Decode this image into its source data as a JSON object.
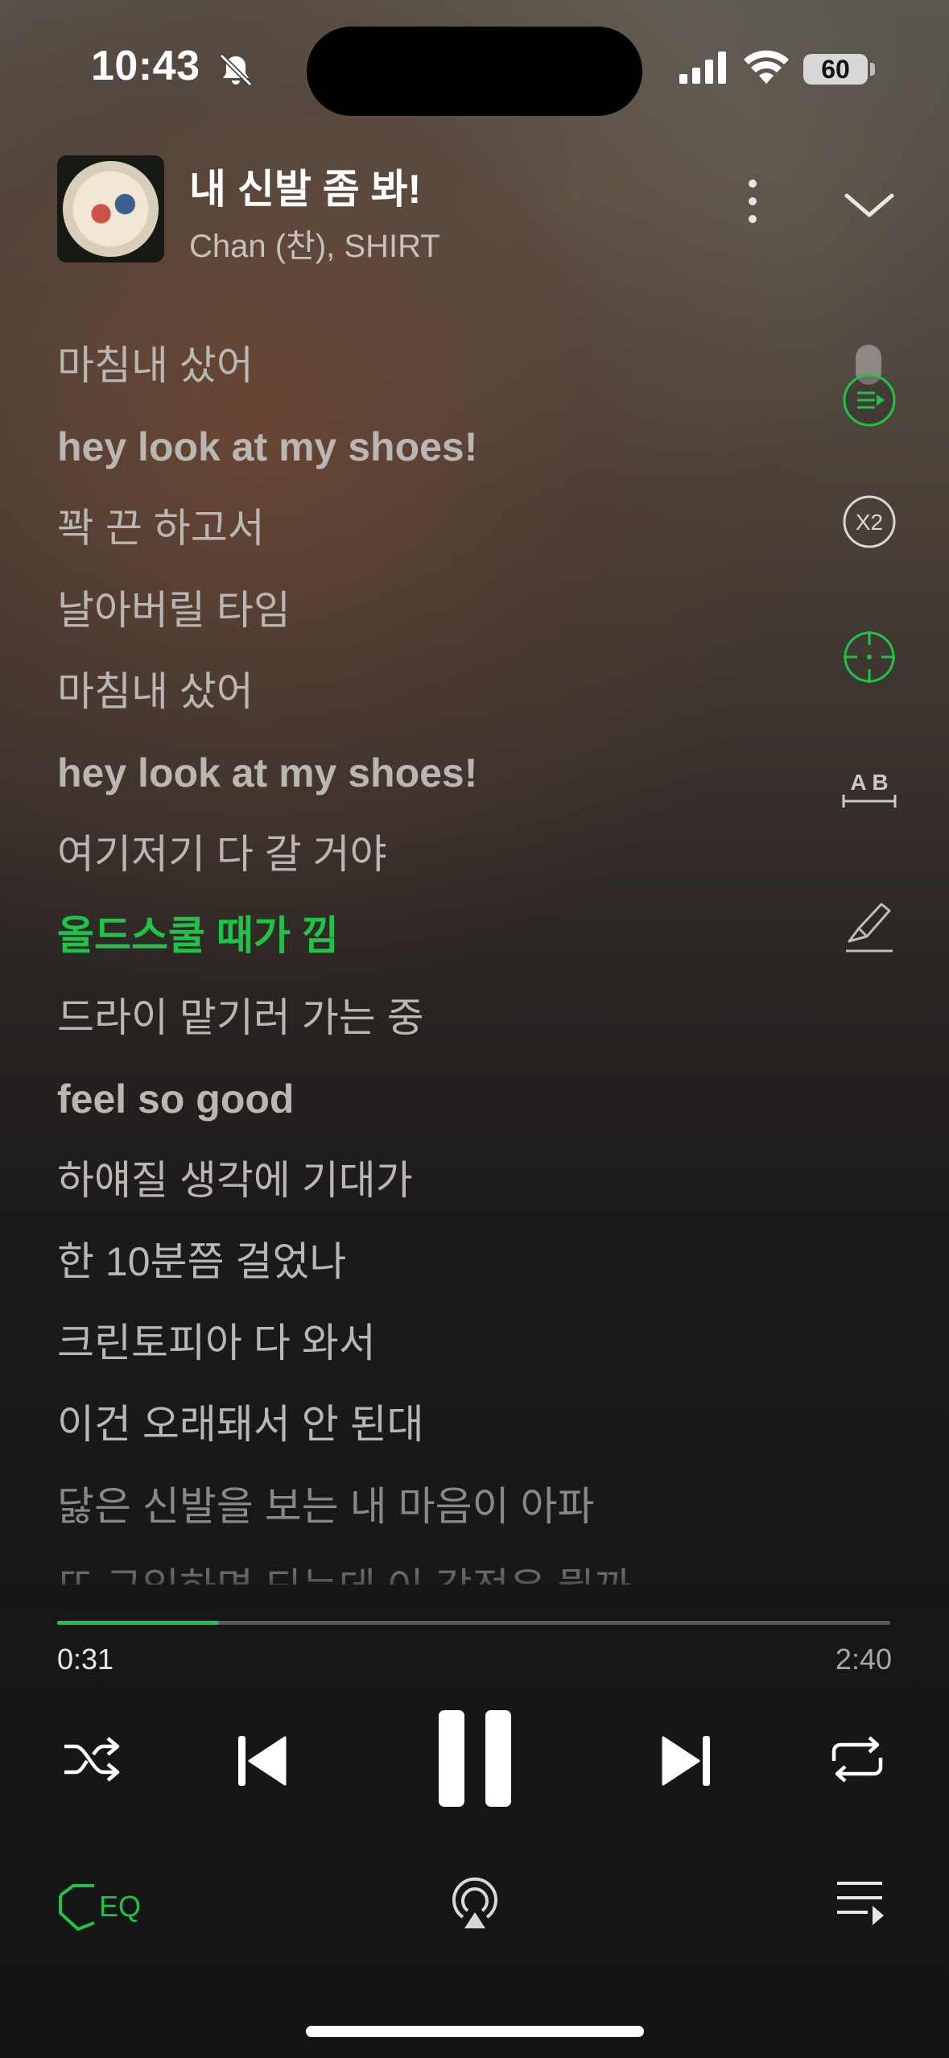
{
  "status_bar": {
    "time": "10:43",
    "battery": "60"
  },
  "now_playing": {
    "title": "내 신발 좀 봐!",
    "artist": "Chan (찬), SHIRT"
  },
  "lyrics": [
    {
      "text": "마침내 샀어",
      "style": "normal"
    },
    {
      "text": "hey look at my shoes!",
      "style": "bold"
    },
    {
      "text": "꽉 끈 하고서",
      "style": "normal"
    },
    {
      "text": "날아버릴 타임",
      "style": "normal"
    },
    {
      "text": "마침내 샀어",
      "style": "normal"
    },
    {
      "text": "hey look at my shoes!",
      "style": "bold"
    },
    {
      "text": "여기저기 다 갈 거야",
      "style": "normal"
    },
    {
      "text": "올드스쿨 때가 낌",
      "style": "active"
    },
    {
      "text": "드라이 맡기러 가는 중",
      "style": "normal"
    },
    {
      "text": "feel so good",
      "style": "bold"
    },
    {
      "text": "하얘질 생각에 기대가",
      "style": "normal"
    },
    {
      "text": "한 10분쯤 걸었나",
      "style": "normal"
    },
    {
      "text": "크린토피아 다 와서",
      "style": "normal"
    },
    {
      "text": "이건 오래돼서 안 된대",
      "style": "normal"
    },
    {
      "text": "닳은 신발을 보는 내 마음이 아파",
      "style": "dim"
    },
    {
      "text": "또 구입하면 되는데 이 감정은 뭘까",
      "style": "faded"
    }
  ],
  "tools": {
    "speed_label": "X2",
    "translate_label": "A B"
  },
  "playback": {
    "current_time": "0:31",
    "duration": "2:40",
    "progress": 0.194
  },
  "bottom": {
    "eq_label": "EQ"
  },
  "colors": {
    "accent": "#1ec447"
  }
}
